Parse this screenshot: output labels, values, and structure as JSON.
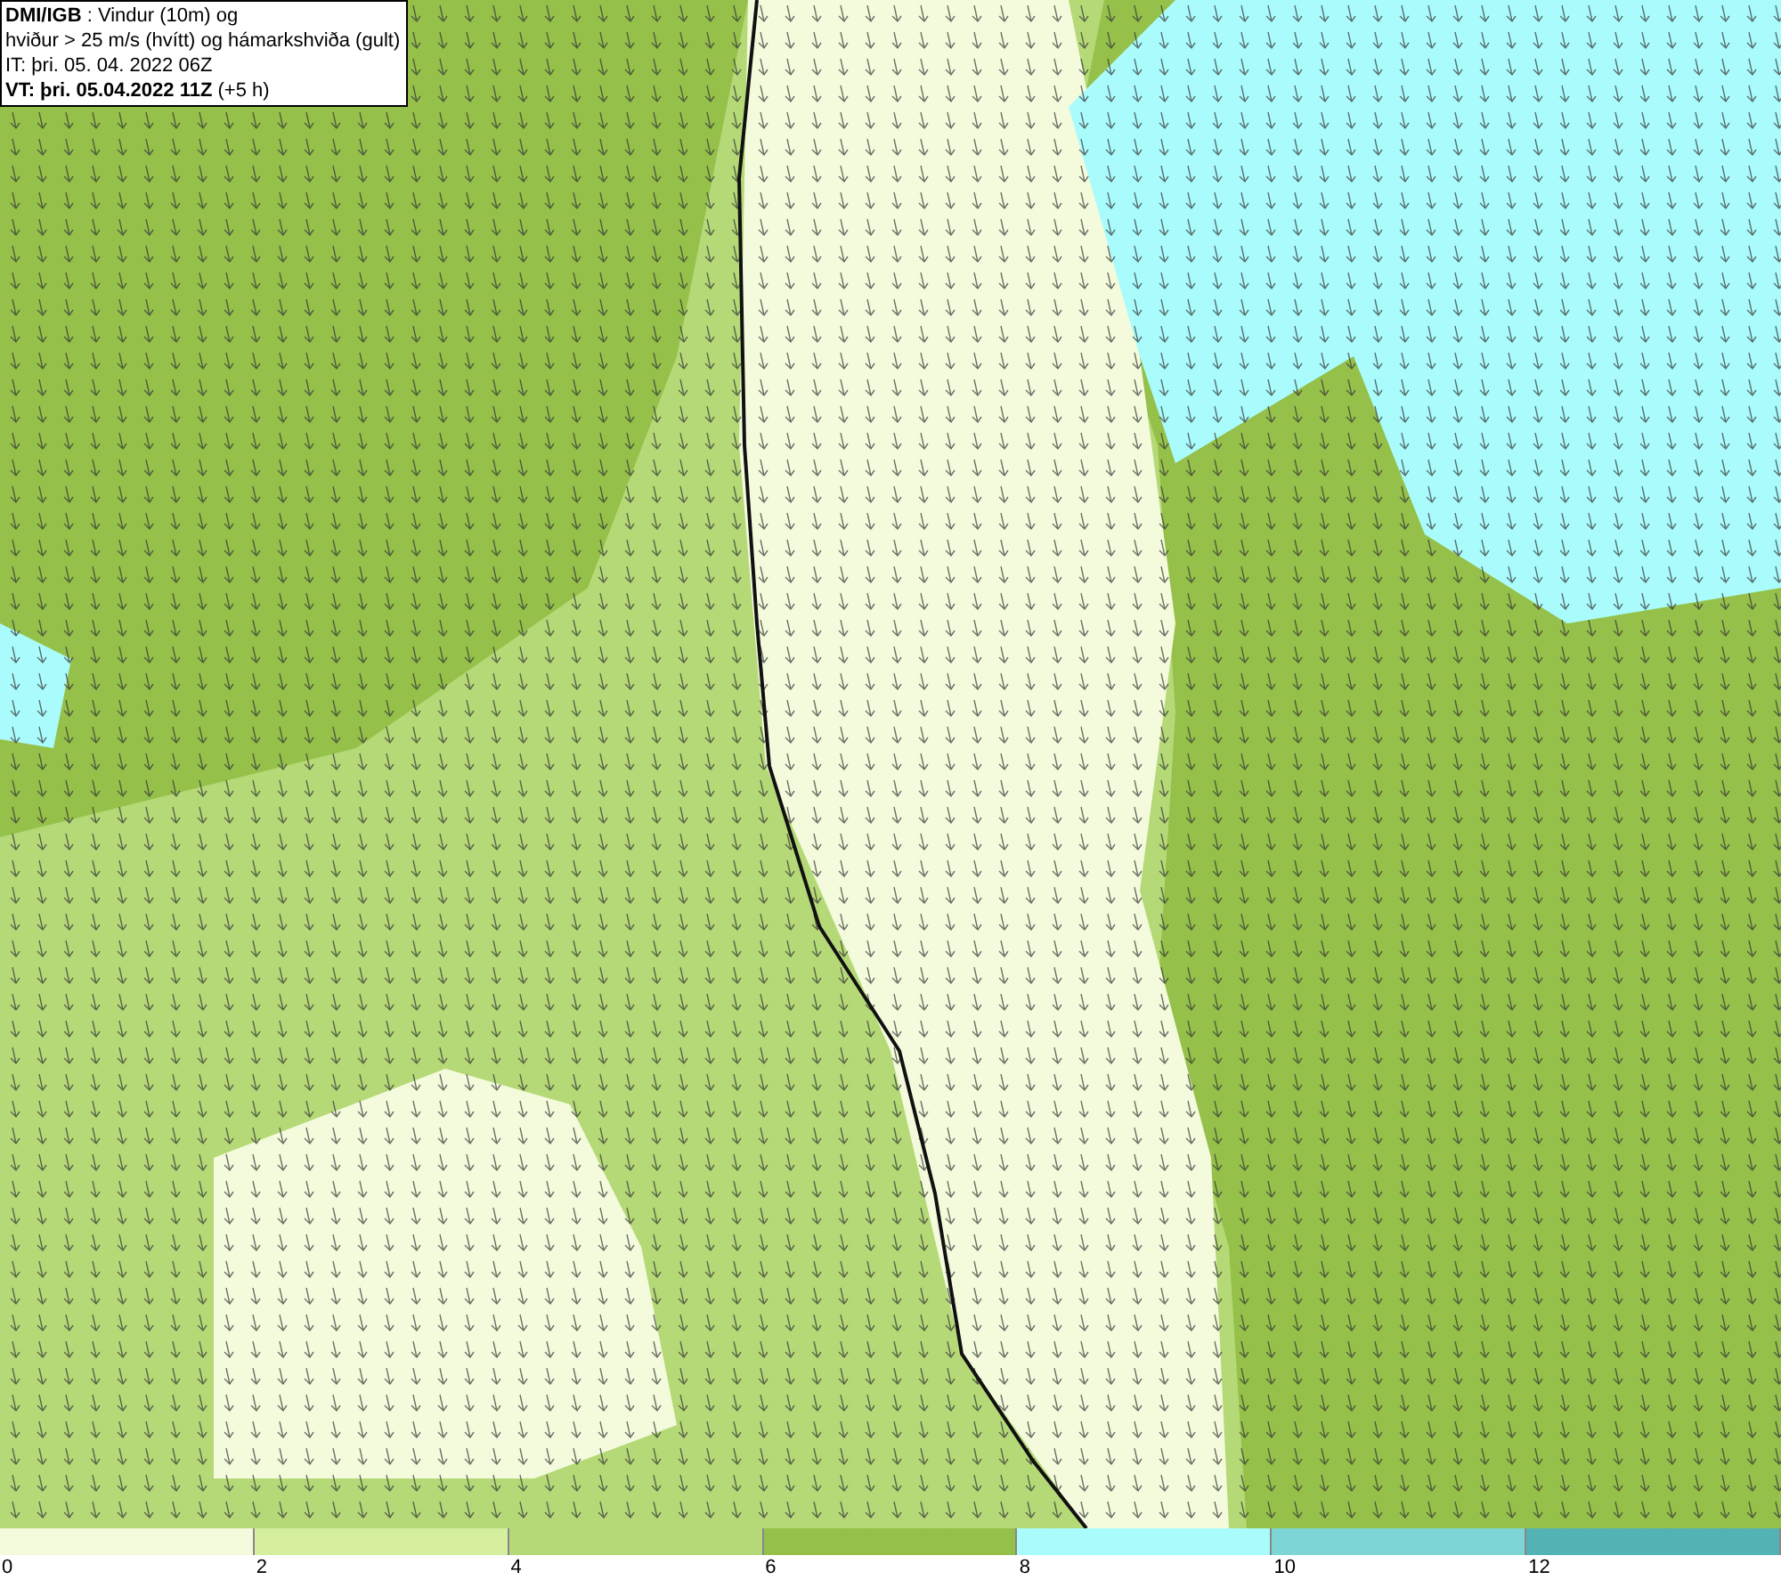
{
  "info_box": {
    "lines": [
      "**DMI/IGB** : Vindur (10m) og",
      "hviður > 25 m/s (hvítt) og hámarkshviða (gult)",
      "IT: þri. 05. 04. 2022 06Z",
      "**VT: þri. 05.04.2022 11Z** (+5 h)"
    ]
  },
  "legend": {
    "bins": [
      {
        "label": "0",
        "color": "#f3fbdc"
      },
      {
        "label": "2",
        "color": "#d5ef9f"
      },
      {
        "label": "4",
        "color": "#b5d977"
      },
      {
        "label": "6",
        "color": "#95c04a"
      },
      {
        "label": "8",
        "color": "#aafcfc"
      },
      {
        "label": "10",
        "color": "#7ed5d5"
      },
      {
        "label": "12",
        "color": "#53b2b4"
      }
    ]
  }
}
